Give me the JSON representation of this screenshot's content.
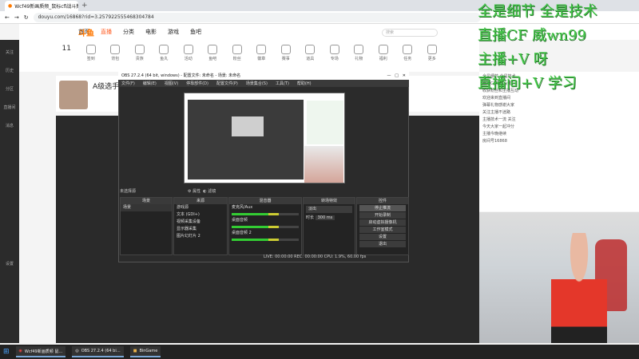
{
  "browser": {
    "tab_title": "Wcf49新画质频_鼠标cfl战斗集 -",
    "new_tab": "+",
    "url": "douyu.com/16868?rid=3.257922555468304784"
  },
  "site": {
    "logo": "斗鱼",
    "nav": [
      "首页",
      "直播",
      "分类",
      "电影",
      "游戏",
      "鱼吧"
    ],
    "search_placeholder": "搜索",
    "left_items": [
      "关注",
      "历史",
      "分区",
      "直播间",
      "消息",
      "设置"
    ],
    "hours_label": "11",
    "room_title": "A级选手_迈",
    "icon_labels": [
      "签到",
      "背包",
      "贵族",
      "鱼丸",
      "活动",
      "鱼吧",
      "粉丝",
      "徽章",
      "赛事",
      "道具",
      "专场",
      "礼物",
      "福利",
      "任务",
      "更多"
    ]
  },
  "chat": {
    "lines": [
      "全是细节 全是技术",
      "直播CF穿越火线",
      "收获粉丝和主播互动",
      "欢迎来到直播间",
      "弹幕礼物感谢大家",
      "关注主播不迷路",
      "主播技术一流 关注",
      "今天大家一起冲分",
      "主播今晚继续",
      "房间号16868"
    ]
  },
  "overlay": {
    "lines": [
      "全是细节 全是技术",
      "直播CF 威wn99",
      "主播+V 呀",
      "直播间+V 学习"
    ]
  },
  "obs": {
    "title": "OBS 27.2.4 (64 bit, windows) - 配置文件: 未命名 - 场景: 未命名",
    "menu": [
      "文件(F)",
      "编辑(E)",
      "视图(V)",
      "停靠部件(D)",
      "配置文件(P)",
      "场景集合(S)",
      "工具(T)",
      "帮助(H)"
    ],
    "scene_label": "未选择源",
    "ctrl_props": "属性",
    "ctrl_filter": "滤镜",
    "docks": {
      "scenes": {
        "title": "场景",
        "items": [
          "场景"
        ]
      },
      "sources": {
        "title": "来源",
        "items": [
          "游戏源",
          "文本 (GDI+)",
          "视频采集设备",
          "显示器采集",
          "图片幻灯片 2"
        ]
      },
      "mixer": {
        "title": "混音器",
        "items": [
          "麦克风/Aux",
          "桌面音频",
          "桌面音频 2"
        ]
      },
      "transitions": {
        "title": "转场特效",
        "fade": "淡出",
        "duration_label": "时长",
        "duration": "300 ms"
      },
      "controls": {
        "title": "控件",
        "buttons": [
          "停止推流",
          "开始录制",
          "启动虚拟摄像机",
          "工作室模式",
          "设置",
          "退出"
        ]
      }
    },
    "status": "LIVE: 00:00:00   REC: 00:00:00   CPU: 1.9%, 60.00 fps"
  },
  "taskbar": {
    "items": [
      "Wcf49新画质频 鼠…",
      "OBS 27.2.4 (64 bi…",
      "BinGame"
    ]
  }
}
